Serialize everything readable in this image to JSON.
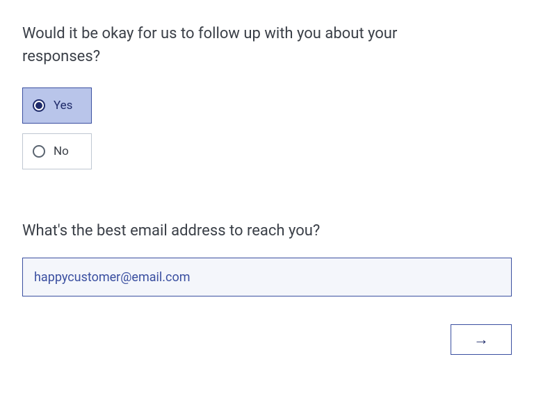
{
  "question1": {
    "text": "Would it be okay for us to follow up with you about your responses?",
    "options": {
      "yes": "Yes",
      "no": "No"
    },
    "selected": "yes"
  },
  "question2": {
    "text": "What's the best email address to reach you?",
    "value": "happycustomer@email.com"
  },
  "icons": {
    "next_arrow": "→"
  }
}
